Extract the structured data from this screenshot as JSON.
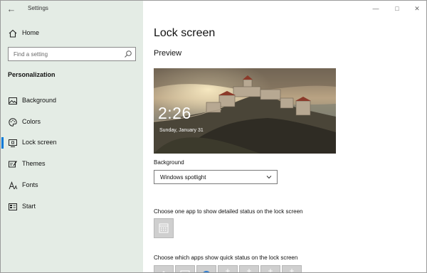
{
  "app": {
    "title": "Settings"
  },
  "sidebar": {
    "home_label": "Home",
    "search_placeholder": "Find a setting",
    "section_heading": "Personalization",
    "items": [
      {
        "label": "Background",
        "icon": "picture-icon"
      },
      {
        "label": "Colors",
        "icon": "palette-icon"
      },
      {
        "label": "Lock screen",
        "icon": "lock-screen-icon",
        "selected": true
      },
      {
        "label": "Themes",
        "icon": "brush-icon"
      },
      {
        "label": "Fonts",
        "icon": "font-icon"
      },
      {
        "label": "Start",
        "icon": "start-icon"
      }
    ]
  },
  "main": {
    "title": "Lock screen",
    "preview_heading": "Preview",
    "preview": {
      "time": "2:26",
      "date": "Sunday, January 31"
    },
    "background_label": "Background",
    "background_value": "Windows spotlight",
    "detailed_status_label": "Choose one app to show detailed status on the lock screen",
    "quick_status_label": "Choose which apps show quick status on the lock screen"
  },
  "colors": {
    "accent": "#0078d7",
    "sidebar_bg": "#e4ece5"
  }
}
